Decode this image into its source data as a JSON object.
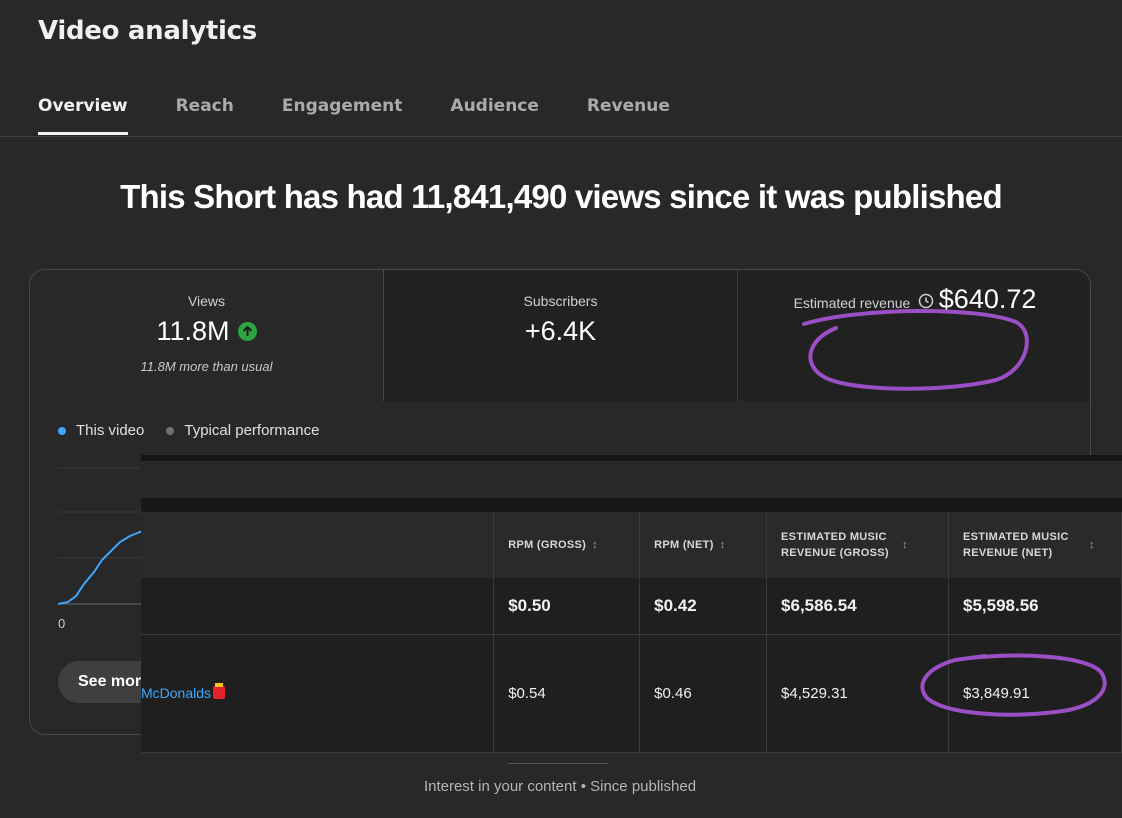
{
  "header": {
    "title": "Video analytics"
  },
  "tabs": [
    {
      "label": "Overview",
      "active": true
    },
    {
      "label": "Reach"
    },
    {
      "label": "Engagement"
    },
    {
      "label": "Audience"
    },
    {
      "label": "Revenue"
    }
  ],
  "headline": "This Short has had 11,841,490 views since it was published",
  "metrics": {
    "views": {
      "label": "Views",
      "value": "11.8M",
      "note": "11.8M more than usual"
    },
    "subscribers": {
      "label": "Subscribers",
      "value": "+6.4K"
    },
    "revenue": {
      "label": "Estimated revenue",
      "value": "$640.72"
    }
  },
  "legend": {
    "this_video": "This video",
    "typical": "Typical performance"
  },
  "chart": {
    "zero_label": "0"
  },
  "see_more_label": "See more",
  "table": {
    "headers": [
      "RPM (GROSS)",
      "RPM (NET)",
      "ESTIMATED MUSIC REVENUE (GROSS)",
      "ESTIMATED MUSIC REVENUE (NET)"
    ],
    "total": [
      "$0.50",
      "$0.42",
      "$6,586.54",
      "$5,598.56"
    ],
    "row": {
      "channel": "McDonalds",
      "values": [
        "$0.54",
        "$0.46",
        "$4,529.31",
        "$3,849.91"
      ]
    }
  },
  "footer": "Interest in your content • Since published",
  "colors": {
    "accent_blue": "#3ea6ff",
    "annotation_purple": "#9b4fc4",
    "up_green": "#2ba640"
  }
}
